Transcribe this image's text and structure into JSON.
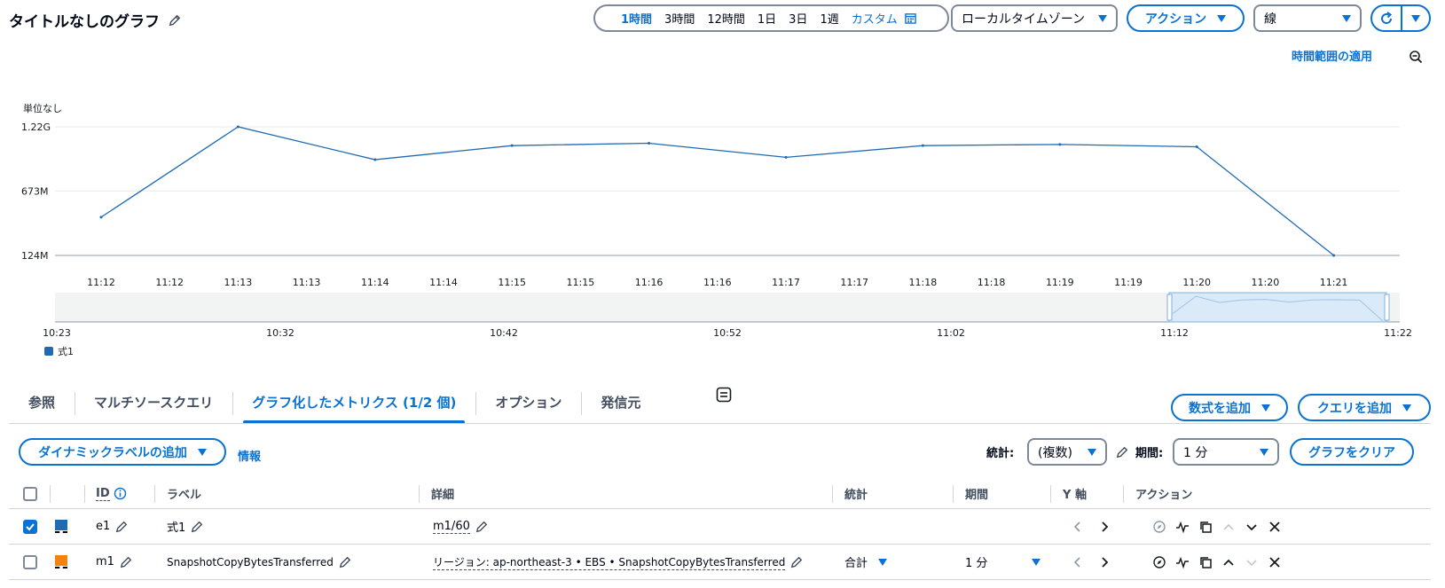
{
  "header": {
    "title": "タイトルなしのグラフ",
    "time_ranges": [
      "1時間",
      "3時間",
      "12時間",
      "1日",
      "3日",
      "1週"
    ],
    "active_range": "1時間",
    "custom_label": "カスタム",
    "timezone": "ローカルタイムゾーン",
    "actions_label": "アクション",
    "graph_type": "線",
    "apply_time_range": "時間範囲の適用"
  },
  "chart_data": {
    "type": "line",
    "ylabel": "単位なし",
    "y_ticks": [
      "1.22G",
      "673M",
      "124M"
    ],
    "y_tick_values": [
      1220000000,
      673000000,
      124000000
    ],
    "x_labels": [
      "11:12",
      "11:12",
      "11:13",
      "11:13",
      "11:14",
      "11:14",
      "11:15",
      "11:15",
      "11:16",
      "11:16",
      "11:17",
      "11:17",
      "11:18",
      "11:18",
      "11:19",
      "11:19",
      "11:20",
      "11:20",
      "11:21"
    ],
    "series": [
      {
        "name": "式1",
        "color": "#1f6ab2",
        "x": [
          "11:12",
          "11:13",
          "11:14",
          "11:15",
          "11:16",
          "11:17",
          "11:18",
          "11:19",
          "11:20",
          "11:21"
        ],
        "values": [
          450000000,
          1220000000,
          940000000,
          1060000000,
          1080000000,
          960000000,
          1060000000,
          1070000000,
          1050000000,
          124000000
        ]
      }
    ],
    "overview_labels": [
      "10:23",
      "10:32",
      "10:42",
      "10:52",
      "11:02",
      "11:12",
      "11:22"
    ],
    "legend": [
      "式1"
    ]
  },
  "tabs": [
    "参照",
    "マルチソースクエリ",
    "グラフ化したメトリクス (1/2 個)",
    "オプション",
    "発信元"
  ],
  "active_tab": "グラフ化したメトリクス (1/2 個)",
  "toolbar": {
    "add_expression": "数式を追加",
    "add_query": "クエリを追加",
    "dynamic_label": "ダイナミックラベルの追加",
    "info": "情報",
    "stat_label": "統計:",
    "stat_value": "(複数)",
    "period_label": "期間:",
    "period_value": "1 分",
    "clear_graph": "グラフをクリア"
  },
  "table": {
    "headers": [
      "ID",
      "ラベル",
      "詳細",
      "統計",
      "期間",
      "Y 軸",
      "アクション"
    ],
    "rows": [
      {
        "checked": true,
        "color": "#1f6ab2",
        "id": "e1",
        "label": "式1",
        "detail": "m1/60",
        "stat": "",
        "period": ""
      },
      {
        "checked": false,
        "color": "#f5820a",
        "id": "m1",
        "label": "SnapshotCopyBytesTransferred",
        "detail": "リージョン: ap-northeast-3 • EBS • SnapshotCopyBytesTransferred",
        "stat": "合計",
        "period": "1 分"
      }
    ]
  }
}
